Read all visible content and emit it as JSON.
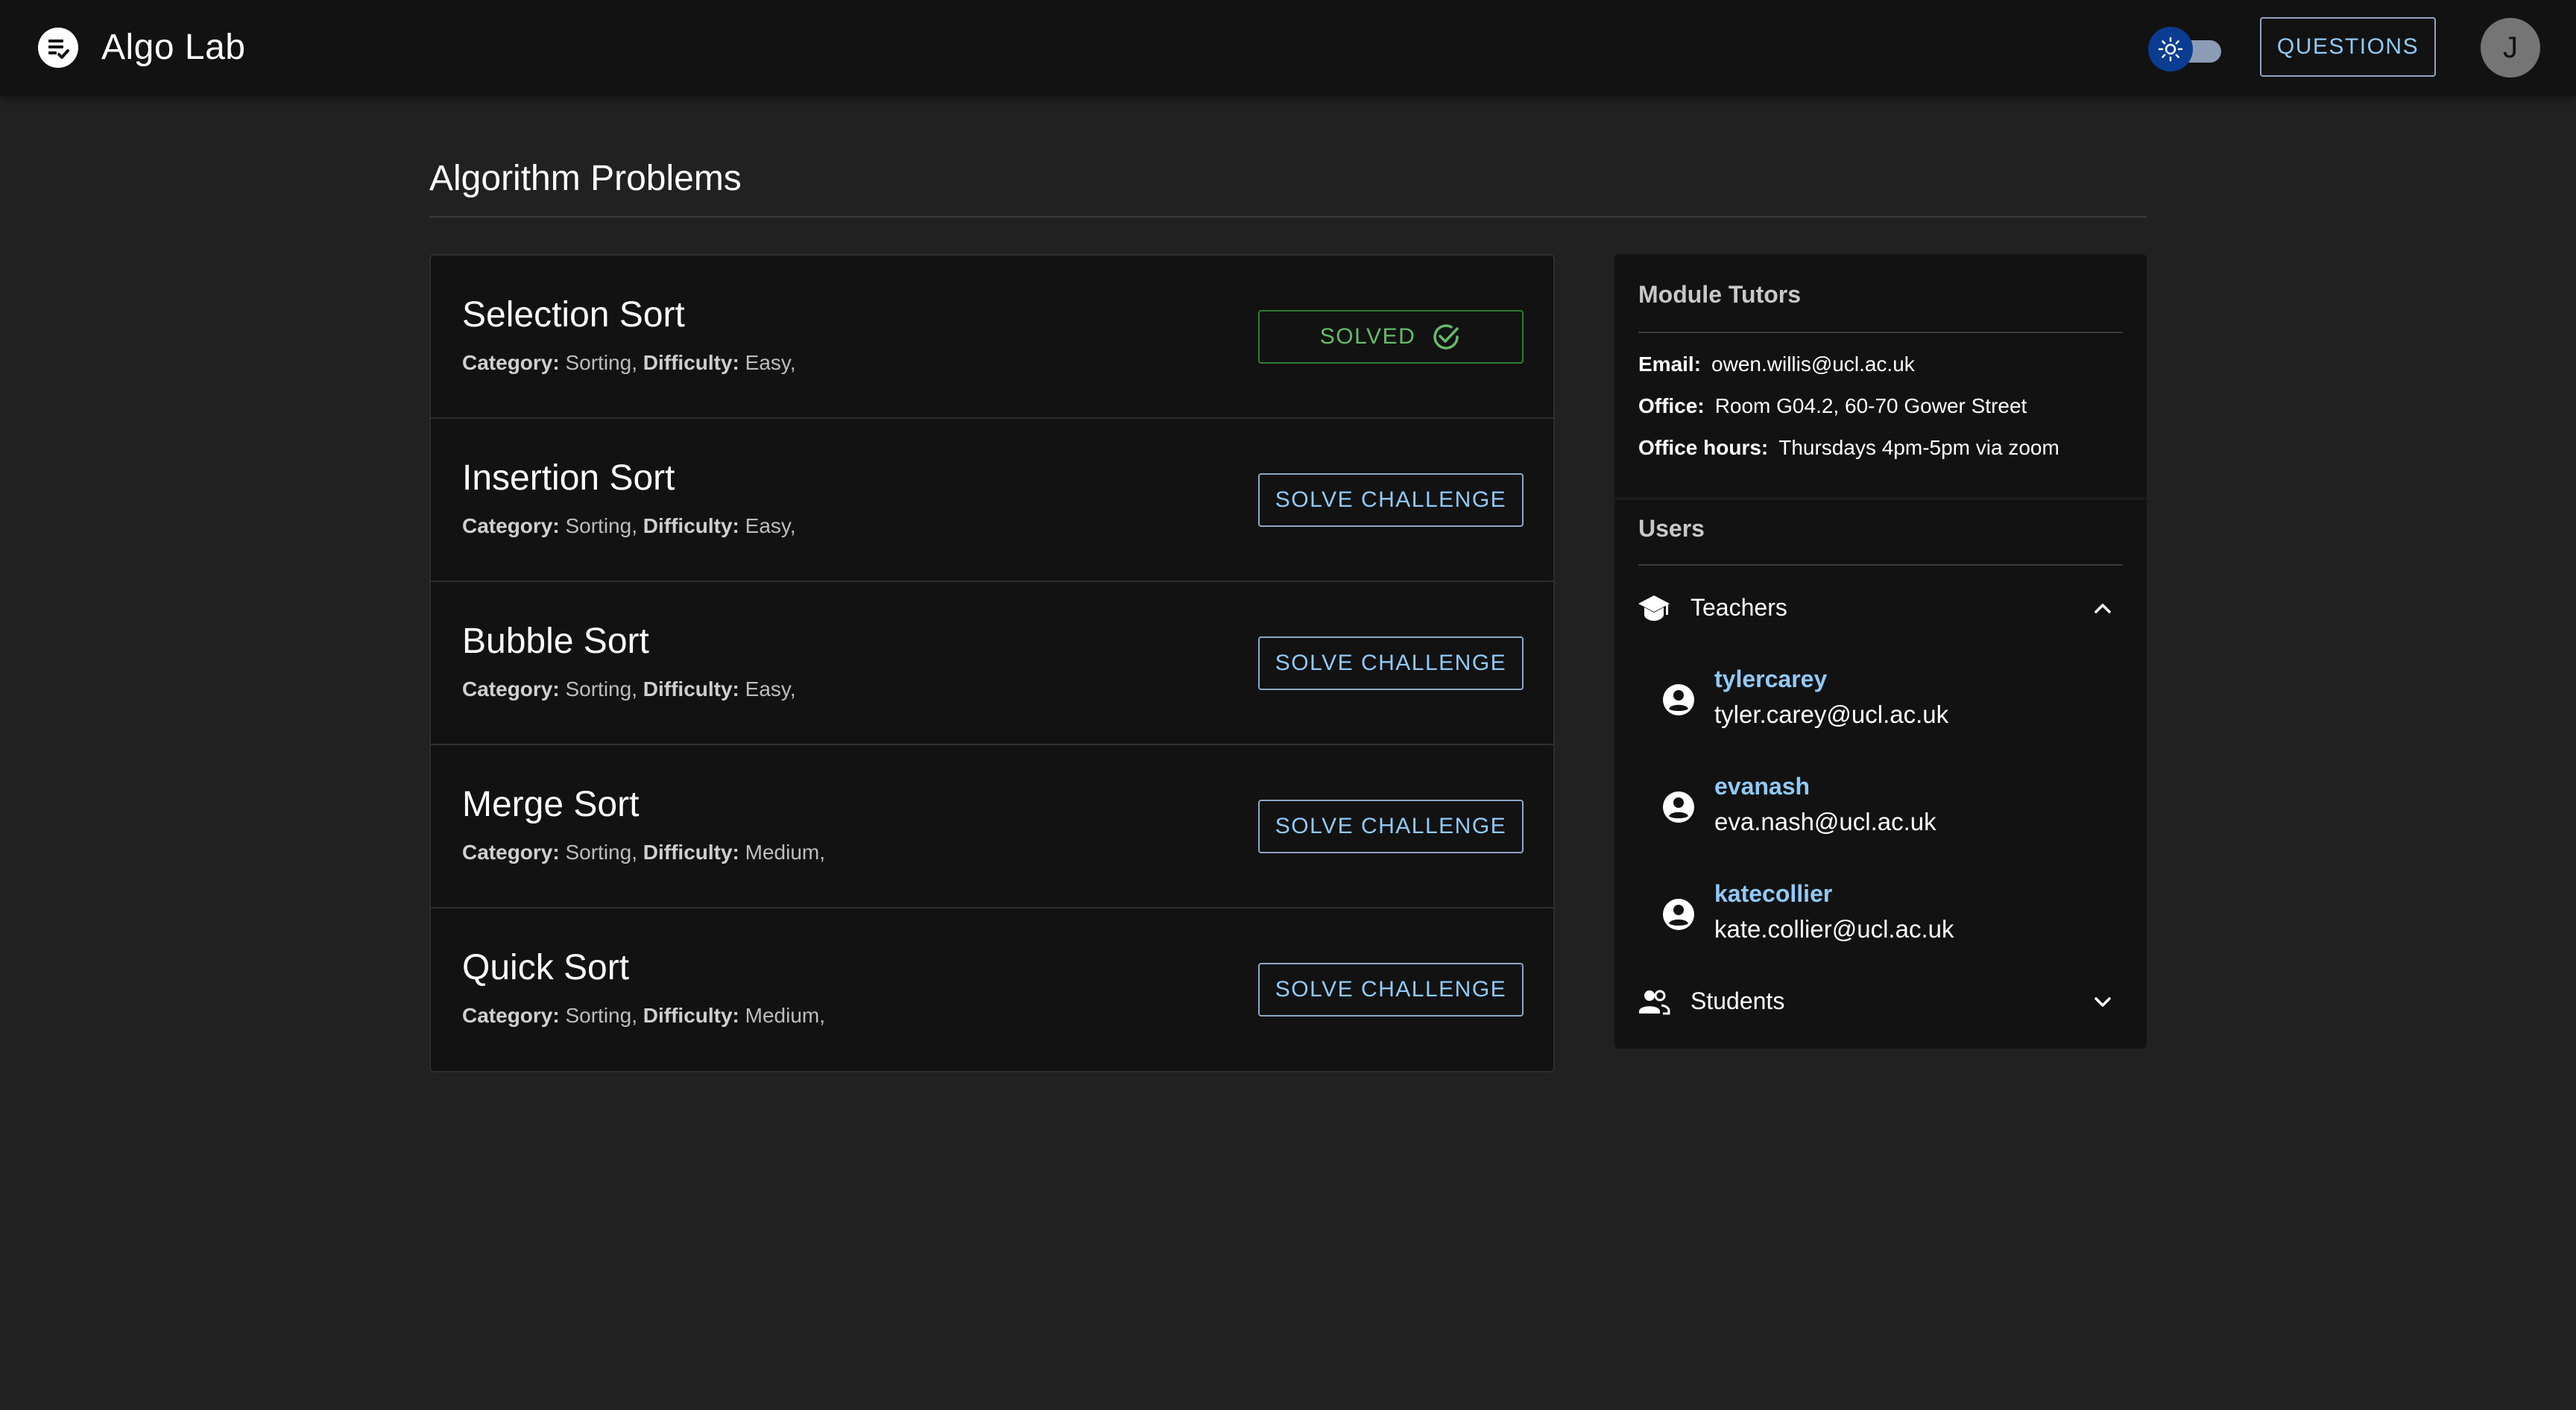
{
  "app": {
    "title": "Algo Lab",
    "questions_label": "QUESTIONS",
    "avatar_initial": "J",
    "icons": {
      "logo": "list-check-icon",
      "theme": "sun-icon"
    }
  },
  "page": {
    "title": "Algorithm Problems"
  },
  "problems": [
    {
      "name": "Selection Sort",
      "category_label": "Category:",
      "category": "Sorting,",
      "difficulty_label": "Difficulty:",
      "difficulty": "Easy,",
      "status": "solved",
      "action": "SOLVED"
    },
    {
      "name": "Insertion Sort",
      "category_label": "Category:",
      "category": "Sorting,",
      "difficulty_label": "Difficulty:",
      "difficulty": "Easy,",
      "status": "unsolved",
      "action": "SOLVE CHALLENGE"
    },
    {
      "name": "Bubble Sort",
      "category_label": "Category:",
      "category": "Sorting,",
      "difficulty_label": "Difficulty:",
      "difficulty": "Easy,",
      "status": "unsolved",
      "action": "SOLVE CHALLENGE"
    },
    {
      "name": "Merge Sort",
      "category_label": "Category:",
      "category": "Sorting,",
      "difficulty_label": "Difficulty:",
      "difficulty": "Medium,",
      "status": "unsolved",
      "action": "SOLVE CHALLENGE"
    },
    {
      "name": "Quick Sort",
      "category_label": "Category:",
      "category": "Sorting,",
      "difficulty_label": "Difficulty:",
      "difficulty": "Medium,",
      "status": "unsolved",
      "action": "SOLVE CHALLENGE"
    }
  ],
  "tutors": {
    "heading": "Module Tutors",
    "email_label": "Email:",
    "email": "owen.willis@ucl.ac.uk",
    "office_label": "Office:",
    "office": "Room G04.2, 60-70 Gower Street",
    "hours_label": "Office hours:",
    "hours": "Thursdays 4pm-5pm via zoom"
  },
  "users": {
    "heading": "Users",
    "teachers": {
      "label": "Teachers",
      "expanded": true,
      "items": [
        {
          "username": "tylercarey",
          "email": "tyler.carey@ucl.ac.uk"
        },
        {
          "username": "evanash",
          "email": "eva.nash@ucl.ac.uk"
        },
        {
          "username": "katecollier",
          "email": "kate.collier@ucl.ac.uk"
        }
      ]
    },
    "students": {
      "label": "Students",
      "expanded": false
    }
  },
  "colors": {
    "accent": "#90caf9",
    "solved": "#66bb6a",
    "background": "#212121",
    "surface": "#121212"
  }
}
